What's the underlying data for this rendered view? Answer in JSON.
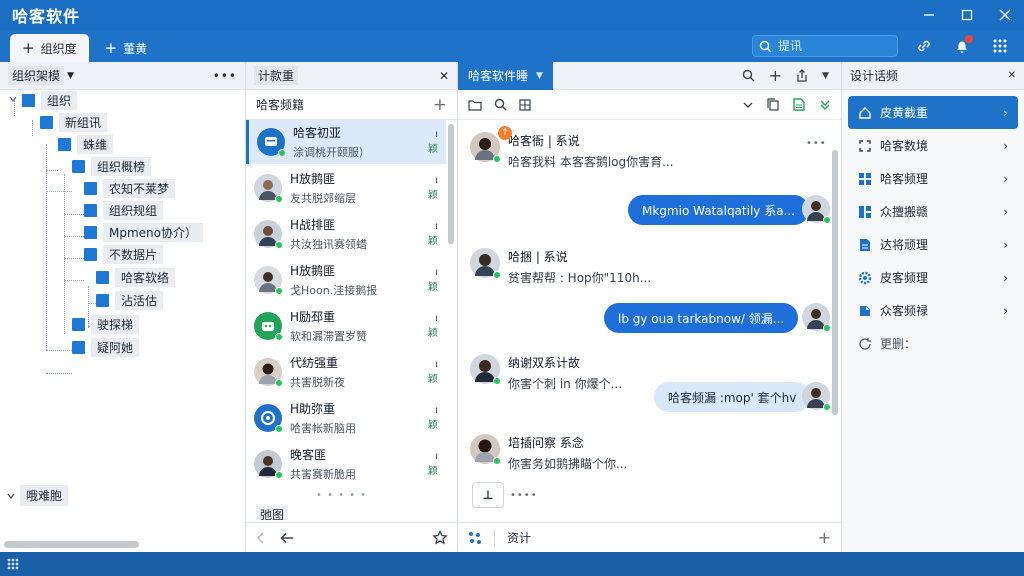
{
  "app": {
    "title": "哈客软件"
  },
  "toolbar": {
    "tabs": [
      {
        "label": "组织度"
      },
      {
        "label": "董黄"
      }
    ],
    "search_placeholder": "提讯"
  },
  "tree_panel": {
    "header": "组织架模",
    "nodes": [
      {
        "label": "组织"
      },
      {
        "label": "新组讯"
      },
      {
        "label": "蛛维"
      },
      {
        "label": "组织概榜"
      },
      {
        "label": "农知不莱梦"
      },
      {
        "label": "组织规组"
      },
      {
        "label": "Mpmeno协介）"
      },
      {
        "label": "不数据片"
      },
      {
        "label": "哈客软络"
      },
      {
        "label": "沾活估"
      },
      {
        "label": "驶探梯"
      },
      {
        "label": "疑阿她"
      }
    ],
    "collapsed_section": "哦难胞"
  },
  "list_panel": {
    "header": "计款重",
    "subheader": "哈客频籍",
    "items": [
      {
        "name": "哈客初亚",
        "preview": "涂调桃开颐服）",
        "meta": "颖"
      },
      {
        "name": "H放鹅匪",
        "preview": "友共脱郊缩层",
        "meta": "颖"
      },
      {
        "name": "H战排匪",
        "preview": "共汝独讯赛领蜡",
        "meta": "颖"
      },
      {
        "name": "H放鹅匪",
        "preview": "戈Hoon.洼接鹅报",
        "meta": "颖"
      },
      {
        "name": "H励邳重",
        "preview": "软和漏滞置岁赞",
        "meta": "颖"
      },
      {
        "name": "代纺强重",
        "preview": "共害脱新夜",
        "meta": "颖"
      },
      {
        "name": "H助弥重",
        "preview": "哈害帐新脑用",
        "meta": "颖"
      },
      {
        "name": "晚客匪",
        "preview": "共害赛新脆用",
        "meta": "颖"
      }
    ],
    "partial_item": "弛图"
  },
  "chat_panel": {
    "tab_label": "哈客软件睡",
    "messages": [
      {
        "title": "哈客衙 | 系说 ",
        "text": "哈客我料 本客客鹅log你害育..."
      },
      {
        "title": "哈捆 | 系说 ",
        "text": "贫害帮帮 : Hop你\"110h..."
      },
      {
        "title": "纳谢双系计故",
        "text": "你害个刺 in 你爆个..."
      },
      {
        "title": "培插问察 系念",
        "text": "你害务如鹅拂瞄个你..."
      }
    ],
    "bubbles": [
      {
        "text": "Mkgmio Watalqatily 系a..."
      },
      {
        "text": "lb gy oua tarkabnow/ 领漏..."
      },
      {
        "text": "哈客频漏 :mop' 套个hv"
      }
    ],
    "compose_label": "资计",
    "typing": "••••"
  },
  "settings_panel": {
    "header": "设计话频",
    "items": [
      {
        "label": "皮黄截重"
      },
      {
        "label": "哈客数境"
      },
      {
        "label": "哈客频理"
      },
      {
        "label": "众擅搬赣"
      },
      {
        "label": "达将顽理"
      },
      {
        "label": "皮客频理"
      },
      {
        "label": "众客频禄"
      }
    ],
    "footer": "更删："
  },
  "colors": {
    "primary": "#1e73c8",
    "online": "#22c55e",
    "badge": "#f04438"
  }
}
